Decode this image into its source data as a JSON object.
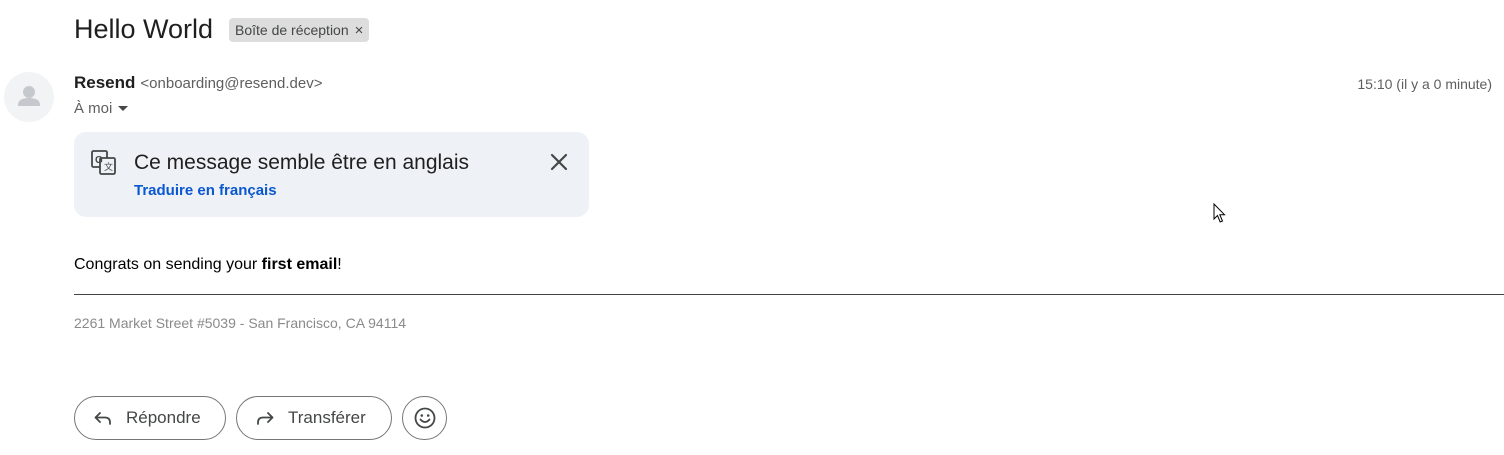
{
  "message": {
    "subject": "Hello World",
    "label_chip": "Boîte de réception",
    "label_remove_icon": "×",
    "sender_name": "Resend",
    "sender_email": "<onboarding@resend.dev>",
    "timestamp": "15:10 (il y a 0 minute)",
    "recipient": "À moi"
  },
  "translate_banner": {
    "title": "Ce message semble être en anglais",
    "link": "Traduire en français",
    "icon": "translate-icon",
    "close_icon": "close-icon"
  },
  "body": {
    "text_before": "Congrats on sending your ",
    "text_bold": "first email",
    "text_after": "!",
    "address": "2261 Market Street #5039 - San Francisco, CA 94114"
  },
  "actions": {
    "reply_label": "Répondre",
    "forward_label": "Transférer",
    "reply_icon": "reply-icon",
    "forward_icon": "forward-icon",
    "emoji_icon": "emoji-icon"
  },
  "colors": {
    "link": "#0b57d0",
    "banner_bg": "#eef2f7",
    "chip_bg": "#dddddd"
  }
}
